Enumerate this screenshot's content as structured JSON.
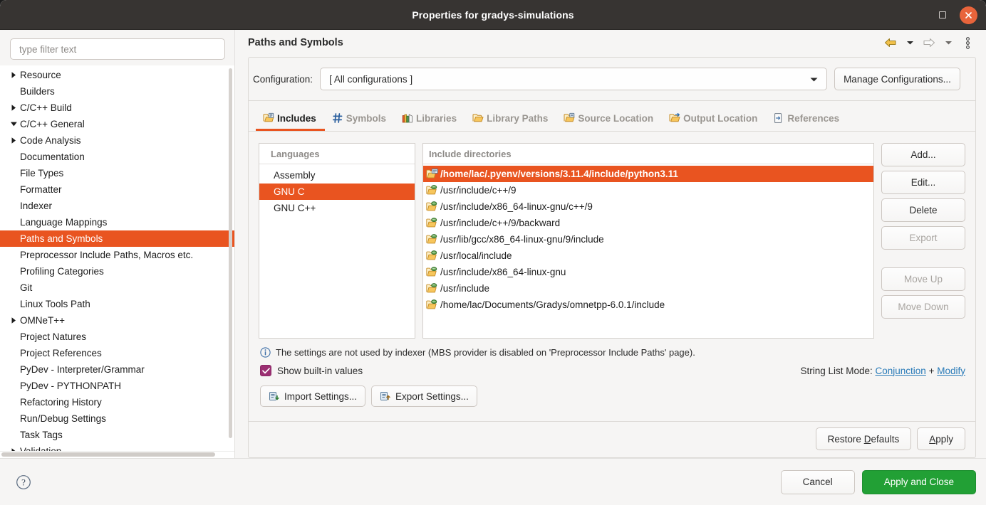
{
  "titlebar": {
    "title": "Properties for gradys-simulations",
    "maximize_icon": "maximize-icon",
    "close_icon": "close-icon"
  },
  "sidebar": {
    "filter": {
      "value": "",
      "placeholder": "type filter text"
    },
    "items": [
      {
        "label": "Resource",
        "level": 0,
        "twisty": "collapsed",
        "selected": false
      },
      {
        "label": "Builders",
        "level": 0,
        "twisty": "none",
        "selected": false
      },
      {
        "label": "C/C++ Build",
        "level": 0,
        "twisty": "collapsed",
        "selected": false
      },
      {
        "label": "C/C++ General",
        "level": 0,
        "twisty": "expanded",
        "selected": false
      },
      {
        "label": "Code Analysis",
        "level": 1,
        "twisty": "collapsed",
        "selected": false
      },
      {
        "label": "Documentation",
        "level": 1,
        "twisty": "none",
        "selected": false
      },
      {
        "label": "File Types",
        "level": 1,
        "twisty": "none",
        "selected": false
      },
      {
        "label": "Formatter",
        "level": 1,
        "twisty": "none",
        "selected": false
      },
      {
        "label": "Indexer",
        "level": 1,
        "twisty": "none",
        "selected": false
      },
      {
        "label": "Language Mappings",
        "level": 1,
        "twisty": "none",
        "selected": false
      },
      {
        "label": "Paths and Symbols",
        "level": 1,
        "twisty": "none",
        "selected": true
      },
      {
        "label": "Preprocessor Include Paths, Macros etc.",
        "level": 1,
        "twisty": "none",
        "selected": false
      },
      {
        "label": "Profiling Categories",
        "level": 1,
        "twisty": "none",
        "selected": false
      },
      {
        "label": "Git",
        "level": 0,
        "twisty": "none",
        "selected": false
      },
      {
        "label": "Linux Tools Path",
        "level": 0,
        "twisty": "none",
        "selected": false
      },
      {
        "label": "OMNeT++",
        "level": 0,
        "twisty": "collapsed",
        "selected": false
      },
      {
        "label": "Project Natures",
        "level": 0,
        "twisty": "none",
        "selected": false
      },
      {
        "label": "Project References",
        "level": 0,
        "twisty": "none",
        "selected": false
      },
      {
        "label": "PyDev - Interpreter/Grammar",
        "level": 0,
        "twisty": "none",
        "selected": false
      },
      {
        "label": "PyDev - PYTHONPATH",
        "level": 0,
        "twisty": "none",
        "selected": false
      },
      {
        "label": "Refactoring History",
        "level": 0,
        "twisty": "none",
        "selected": false
      },
      {
        "label": "Run/Debug Settings",
        "level": 0,
        "twisty": "none",
        "selected": false
      },
      {
        "label": "Task Tags",
        "level": 0,
        "twisty": "none",
        "selected": false
      },
      {
        "label": "Validation",
        "level": 0,
        "twisty": "collapsed",
        "selected": false
      }
    ]
  },
  "page": {
    "title": "Paths and Symbols",
    "nav": {
      "back_icon": "back-arrow-icon",
      "back_menu_icon": "chevron-down-icon",
      "forward_icon": "forward-arrow-icon",
      "forward_menu_icon": "chevron-down-icon",
      "menu_icon": "vertical-dots-icon"
    }
  },
  "configuration": {
    "label": "Configuration:",
    "value": "[ All configurations ]",
    "dropdown_icon": "chevron-down-icon",
    "manage_label": "Manage Configurations..."
  },
  "tabs": [
    {
      "label": "Includes",
      "icon": "includes-icon",
      "active": true
    },
    {
      "label": "Symbols",
      "icon": "hash-icon",
      "active": false
    },
    {
      "label": "Libraries",
      "icon": "books-icon",
      "active": false
    },
    {
      "label": "Library Paths",
      "icon": "folder-open-icon",
      "active": false
    },
    {
      "label": "Source Location",
      "icon": "folder-source-icon",
      "active": false
    },
    {
      "label": "Output Location",
      "icon": "folder-output-icon",
      "active": false
    },
    {
      "label": "References",
      "icon": "reference-icon",
      "active": false
    }
  ],
  "languages": {
    "header": "Languages",
    "items": [
      {
        "label": "Assembly",
        "selected": false
      },
      {
        "label": "GNU C",
        "selected": true
      },
      {
        "label": "GNU C++",
        "selected": false
      }
    ]
  },
  "include_directories": {
    "header": "Include directories",
    "items": [
      {
        "path": "/home/lac/.pyenv/versions/3.11.4/include/python3.11",
        "icon": "include-folder-icon",
        "selected": true
      },
      {
        "path": "/usr/include/c++/9",
        "icon": "builtin-folder-icon",
        "selected": false
      },
      {
        "path": "/usr/include/x86_64-linux-gnu/c++/9",
        "icon": "builtin-folder-icon",
        "selected": false
      },
      {
        "path": "/usr/include/c++/9/backward",
        "icon": "builtin-folder-icon",
        "selected": false
      },
      {
        "path": "/usr/lib/gcc/x86_64-linux-gnu/9/include",
        "icon": "builtin-folder-icon",
        "selected": false
      },
      {
        "path": "/usr/local/include",
        "icon": "builtin-folder-icon",
        "selected": false
      },
      {
        "path": "/usr/include/x86_64-linux-gnu",
        "icon": "builtin-folder-icon",
        "selected": false
      },
      {
        "path": "/usr/include",
        "icon": "builtin-folder-icon",
        "selected": false
      },
      {
        "path": "/home/lac/Documents/Gradys/omnetpp-6.0.1/include",
        "icon": "builtin-folder-icon",
        "selected": false
      }
    ]
  },
  "side_buttons": [
    {
      "label": "Add...",
      "enabled": true
    },
    {
      "label": "Edit...",
      "enabled": true
    },
    {
      "label": "Delete",
      "enabled": true
    },
    {
      "label": "Export",
      "enabled": false
    },
    {
      "label": "Move Up",
      "enabled": false
    },
    {
      "label": "Move Down",
      "enabled": false
    }
  ],
  "footer_info": {
    "icon": "info-icon",
    "text": "The settings are not used by indexer (MBS provider is disabled on 'Preprocessor Include Paths' page)."
  },
  "show_builtin": {
    "label": "Show built-in values",
    "checked": true,
    "check_icon": "checkmark-icon"
  },
  "string_list_mode": {
    "prefix": "String List Mode:",
    "link1": "Conjunction",
    "separator": "+",
    "link2": "Modify"
  },
  "settings_buttons": [
    {
      "label": "Import Settings...",
      "icon": "import-icon"
    },
    {
      "label": "Export Settings...",
      "icon": "export-icon"
    }
  ],
  "panel_actions": [
    {
      "label": "Restore Defaults",
      "mnemonic": "D"
    },
    {
      "label": "Apply",
      "mnemonic": "A"
    }
  ],
  "dialog_footer": {
    "help_icon": "help-icon",
    "cancel_label": "Cancel",
    "apply_close_label": "Apply and Close"
  },
  "colors": {
    "accent": "#e95420",
    "titlebar": "#373432",
    "primary_button": "#22a035",
    "link": "#2a7bb8",
    "checkbox": "#9b2f72"
  }
}
